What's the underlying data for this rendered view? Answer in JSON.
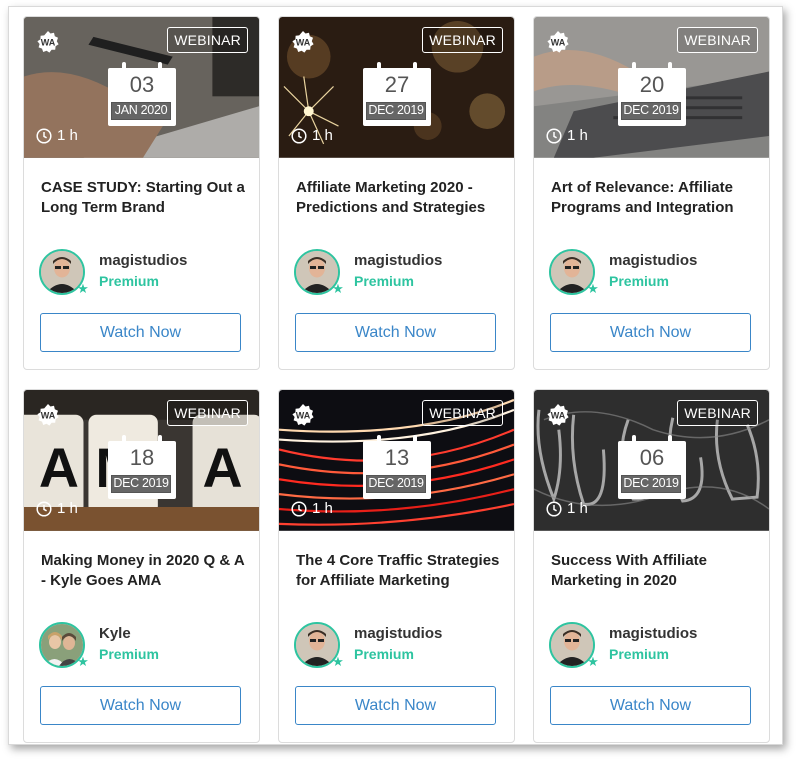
{
  "badge_label": "WEBINAR",
  "button_label": "Watch Now",
  "cards": [
    {
      "title": "CASE STUDY: Starting Out a Long Term Brand",
      "day": "03",
      "month": "JAN 2020",
      "duration": "1 h",
      "author": "magistudios",
      "tier": "Premium",
      "theme": "writing"
    },
    {
      "title": "Affiliate Marketing 2020 - Predictions and Strategies",
      "day": "27",
      "month": "DEC 2019",
      "duration": "1 h",
      "author": "magistudios",
      "tier": "Premium",
      "theme": "sparkler"
    },
    {
      "title": "Art of Relevance: Affiliate Programs and Integration",
      "day": "20",
      "month": "DEC 2019",
      "duration": "1 h",
      "author": "magistudios",
      "tier": "Premium",
      "theme": "laptop"
    },
    {
      "title": "Making Money in 2020 Q & A - Kyle Goes AMA",
      "day": "18",
      "month": "DEC 2019",
      "duration": "1 h",
      "author": "Kyle",
      "tier": "Premium",
      "theme": "ama"
    },
    {
      "title": "The 4 Core Traffic Strategies for Affiliate Marketing",
      "day": "13",
      "month": "DEC 2019",
      "duration": "1 h",
      "author": "magistudios",
      "tier": "Premium",
      "theme": "traffic"
    },
    {
      "title": "Success With Affiliate Marketing in 2020",
      "day": "06",
      "month": "DEC 2019",
      "duration": "1 h",
      "author": "magistudios",
      "tier": "Premium",
      "theme": "chalk"
    }
  ],
  "colors": {
    "accent": "#2ec4a0",
    "button": "#3a86c8"
  }
}
